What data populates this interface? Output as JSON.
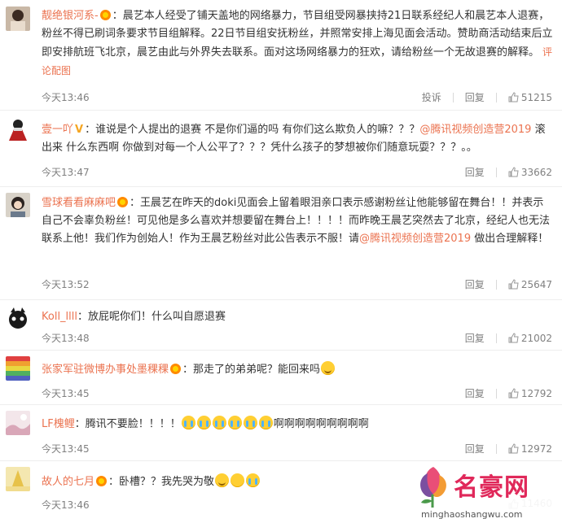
{
  "comments": [
    {
      "user": "靓绝银河系-",
      "text": "：晨艺本人经受了铺天盖地的网络暴力，节目组受网暴挟持21日联系经纪人和晨艺本人退赛，粉丝不得已刷词条要求节目组解释。22日节目组安抚粉丝，并照常安排上海见面会活动。赞助商活动结束后立即安排航班飞北京，晨艺由此与外界失去联系。面对这场网络暴力的狂欢，请给粉丝一个无故退赛的解释。",
      "extra_link": "评论配图",
      "time": "今天13:46",
      "report": "投诉",
      "reply": "回复",
      "likes": "51215"
    },
    {
      "user": "壹一吖",
      "text_a": "：谁说是个人提出的退赛 不是你们逼的吗 有你们这么欺负人的嘛？？？",
      "mention": "@腾讯视频创造营2019",
      "text_b": " 滚出来 什么东西啊 你做到对每一个人公平了？？？凭什么孩子的梦想被你们随意玩耍？？？。。",
      "time": "今天13:47",
      "reply": "回复",
      "likes": "33662"
    },
    {
      "user": "雪球看看麻麻吧",
      "text_a": "：王晨艺在昨天的doki见面会上留着眼泪亲口表示感谢粉丝让他能够留在舞台！！并表示自己不会辜负粉丝！可见他是多么喜欢并想要留在舞台上！！！！而昨晚王晨艺突然去了北京，经纪人也无法联系上他！我们作为创始人！作为王晨艺粉丝对此公告表示不服！请",
      "mention": "@腾讯视频创造营2019",
      "text_b": " 做出合理解释！",
      "time": "今天13:52",
      "reply": "回复",
      "likes": "25647"
    },
    {
      "user": "Koll_llll",
      "text": "：放屁呢你们！什么叫自愿退赛",
      "time": "今天13:48",
      "reply": "回复",
      "likes": "21002"
    },
    {
      "user": "张家军驻微博办事处墨稞稞",
      "text": "：那走了的弟弟呢？能回来吗",
      "time": "今天13:45",
      "reply": "回复",
      "likes": "12792"
    },
    {
      "user": "LF槐鲤",
      "text_a": "：腾讯不要脸！！！！",
      "text_b": "啊啊啊啊啊啊啊啊啊",
      "time": "今天13:45",
      "reply": "回复",
      "likes": "12972"
    },
    {
      "user": "故人的七月",
      "text": "：卧槽？？我先哭为敬",
      "time": "今天13:46",
      "likes": "11460"
    }
  ],
  "watermark": {
    "title": "名豪网",
    "url": "minghaoshangwu.com"
  },
  "colors": {
    "accent": "#eb7350",
    "meta": "#808080",
    "watermark": "#e0285a"
  }
}
